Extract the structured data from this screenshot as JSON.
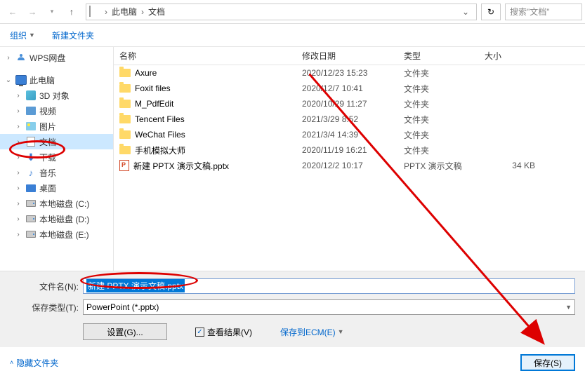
{
  "nav": {
    "breadcrumb": [
      "此电脑",
      "文档"
    ],
    "search_placeholder": "搜索\"文档\""
  },
  "toolbar": {
    "organize": "组织",
    "new_folder": "新建文件夹"
  },
  "sidebar": {
    "items": [
      {
        "label": "WPS网盘",
        "icon": "wps",
        "expand": ">"
      },
      {
        "label": "此电脑",
        "icon": "pc",
        "expand": "v"
      },
      {
        "label": "3D 对象",
        "icon": "cube",
        "expand": ">",
        "indent": true
      },
      {
        "label": "视频",
        "icon": "video",
        "expand": ">",
        "indent": true
      },
      {
        "label": "图片",
        "icon": "image",
        "expand": ">",
        "indent": true
      },
      {
        "label": "文档",
        "icon": "doc",
        "expand": ">",
        "indent": true,
        "selected": true
      },
      {
        "label": "下载",
        "icon": "download",
        "expand": ">",
        "indent": true
      },
      {
        "label": "音乐",
        "icon": "music",
        "expand": ">",
        "indent": true
      },
      {
        "label": "桌面",
        "icon": "desktop",
        "expand": ">",
        "indent": true
      },
      {
        "label": "本地磁盘 (C:)",
        "icon": "disk",
        "expand": ">",
        "indent": true
      },
      {
        "label": "本地磁盘 (D:)",
        "icon": "disk",
        "expand": ">",
        "indent": true
      },
      {
        "label": "本地磁盘 (E:)",
        "icon": "disk",
        "expand": ">",
        "indent": true
      }
    ]
  },
  "columns": {
    "name": "名称",
    "date": "修改日期",
    "type": "类型",
    "size": "大小"
  },
  "files": [
    {
      "name": "Axure",
      "date": "2020/12/23 15:23",
      "type": "文件夹",
      "size": "",
      "icon": "folder"
    },
    {
      "name": "Foxit files",
      "date": "2020/12/7 10:41",
      "type": "文件夹",
      "size": "",
      "icon": "folder"
    },
    {
      "name": "M_PdfEdit",
      "date": "2020/10/29 11:27",
      "type": "文件夹",
      "size": "",
      "icon": "folder"
    },
    {
      "name": "Tencent Files",
      "date": "2021/3/29 8:52",
      "type": "文件夹",
      "size": "",
      "icon": "folder"
    },
    {
      "name": "WeChat Files",
      "date": "2021/3/4 14:39",
      "type": "文件夹",
      "size": "",
      "icon": "folder"
    },
    {
      "name": "手机模拟大师",
      "date": "2020/11/19 16:21",
      "type": "文件夹",
      "size": "",
      "icon": "folder"
    },
    {
      "name": "新建 PPTX 演示文稿.pptx",
      "date": "2020/12/2 10:17",
      "type": "PPTX 演示文稿",
      "size": "34 KB",
      "icon": "pptx"
    }
  ],
  "form": {
    "filename_label": "文件名(N):",
    "filename_value": "新建 PPTX 演示文稿.pptx",
    "filetype_label": "保存类型(T):",
    "filetype_value": "PowerPoint (*.pptx)",
    "settings": "设置(G)...",
    "view_result": "查看结果(V)",
    "save_ecm": "保存到ECM(E)",
    "hide_folders": "隐藏文件夹",
    "save": "保存(S)"
  }
}
